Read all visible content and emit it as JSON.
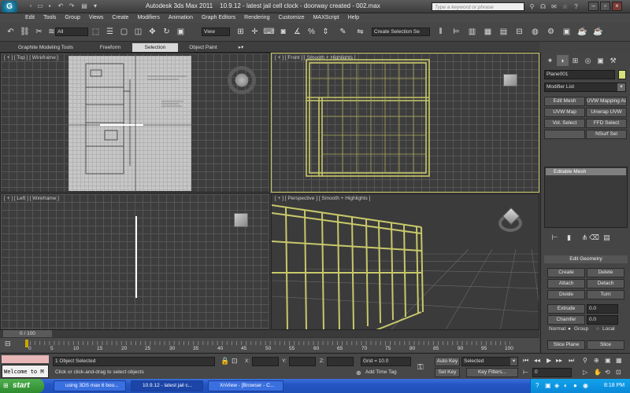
{
  "title": {
    "app": "Autodesk 3ds Max  2011",
    "file": "10.9.12 - latest jail cell clock - doorway created - 002.max",
    "logo": "G"
  },
  "search": {
    "placeholder": "Type a keyword or phrase"
  },
  "menu": [
    "Edit",
    "Tools",
    "Group",
    "Views",
    "Create",
    "Modifiers",
    "Animation",
    "Graph Editors",
    "Rendering",
    "Customize",
    "MAXScript",
    "Help"
  ],
  "toolbar": {
    "selection_filter": "All",
    "ref_coord": "View",
    "named_selection": "Create Selection Se"
  },
  "ribbon": {
    "tabs": [
      "Graphite Modeling Tools",
      "Freeform",
      "Selection",
      "Object Paint"
    ]
  },
  "viewports": {
    "top": {
      "label": "[ + ] [ Top ] [ Wireframe ]"
    },
    "front": {
      "label": "[ + ] [ Front ] [ Smooth + Highlights ]"
    },
    "left": {
      "label": "[ + ] [ Left ] [ Wireframe ]"
    },
    "perspective": {
      "label": "[ + ] [ Perspective ] [ Smooth + Highlights ]"
    }
  },
  "command_panel": {
    "object_name": "Plane001",
    "modifier_list": "Modifier List",
    "modifier_buttons": [
      "Edit Mesh",
      "UVW Mapping Ac",
      "UVW Map",
      "Unwrap UVW",
      "Vol. Select",
      "FFD Select",
      "",
      "NSurf Sel"
    ],
    "stack_item": "Editable Mesh",
    "rollout_title": "Edit Geometry",
    "geo_buttons": [
      "Create",
      "Delete",
      "Attach",
      "Detach",
      "Divide",
      "Turn"
    ],
    "extrude_label": "Extrude",
    "extrude_value": "0.0",
    "chamfer_label": "Chamfer",
    "chamfer_value": "0.0",
    "normal_label": "Normal:",
    "normal_group": "Group",
    "normal_local": "Local",
    "slice_plane": "Slice Plane",
    "slice": "Slice"
  },
  "timeline": {
    "frame": "0 / 100",
    "ticks": [
      "0",
      "5",
      "10",
      "15",
      "20",
      "25",
      "30",
      "35",
      "40",
      "45",
      "50",
      "55",
      "60",
      "65",
      "70",
      "75",
      "80",
      "85",
      "90",
      "95",
      "100"
    ]
  },
  "status": {
    "maxscript_listener": "Welcome to M",
    "selected_count": "1 Object Selected",
    "prompt": "Click or click-and-drag to select objects",
    "x_label": "X:",
    "y_label": "Y:",
    "z_label": "Z:",
    "grid": "Grid = 10.0",
    "add_time_tag": "Add Time Tag",
    "auto_key": "Auto Key",
    "set_key": "Set Key",
    "key_filter_value": "Selected",
    "key_filters": "Key Filters...",
    "frame_field": "0"
  },
  "taskbar": {
    "start": "start",
    "tasks": [
      "using 3DS max 6 boo...",
      "10.9.12 - latest jail c...",
      "XnView - [Browser - C..."
    ],
    "time": "8:18 PM"
  },
  "colors": {
    "accent": "#c8c86a",
    "viewport_bg": "#3d3d3d",
    "active_tab": "#d8d8d8"
  }
}
